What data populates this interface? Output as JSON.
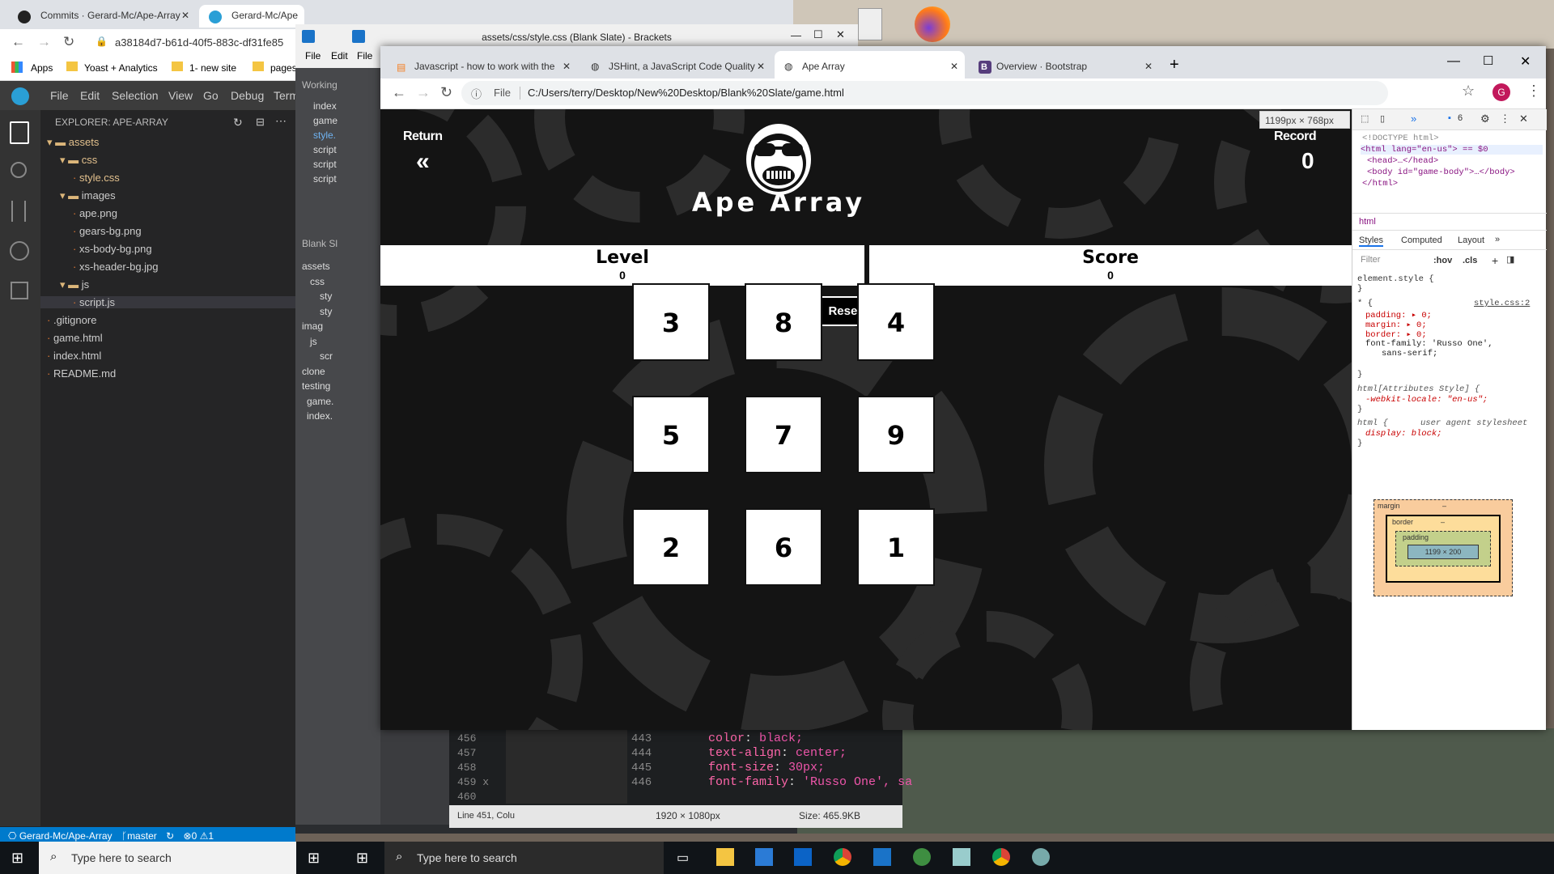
{
  "back_browser": {
    "tabs": [
      {
        "title": "Commits · Gerard-Mc/Ape-Array"
      },
      {
        "title": "Gerard-Mc/Ape"
      }
    ],
    "url": "a38184d7-b61d-40f5-883c-df31fe85",
    "bookmarks": [
      "Apps",
      "Yoast + Analytics",
      "1- new site",
      "pages"
    ]
  },
  "vscode": {
    "menu": [
      "File",
      "Edit",
      "Selection",
      "View",
      "Go",
      "Debug",
      "Term"
    ],
    "explorer_title": "EXPLORER: APE-ARRAY",
    "tree": [
      {
        "label": "assets",
        "depth": 0,
        "kind": "folder"
      },
      {
        "label": "css",
        "depth": 1,
        "kind": "folder"
      },
      {
        "label": "style.css",
        "depth": 2,
        "kind": "file"
      },
      {
        "label": "images",
        "depth": 1,
        "kind": "folder"
      },
      {
        "label": "ape.png",
        "depth": 2,
        "kind": "file"
      },
      {
        "label": "gears-bg.png",
        "depth": 2,
        "kind": "file"
      },
      {
        "label": "xs-body-bg.png",
        "depth": 2,
        "kind": "file"
      },
      {
        "label": "xs-header-bg.jpg",
        "depth": 2,
        "kind": "file"
      },
      {
        "label": "js",
        "depth": 1,
        "kind": "folder"
      },
      {
        "label": "script.js",
        "depth": 2,
        "kind": "file"
      },
      {
        "label": ".gitignore",
        "depth": 0,
        "kind": "file"
      },
      {
        "label": "game.html",
        "depth": 0,
        "kind": "file"
      },
      {
        "label": "index.html",
        "depth": 0,
        "kind": "file"
      },
      {
        "label": "README.md",
        "depth": 0,
        "kind": "file"
      }
    ],
    "status_repo": "Gerard-Mc/Ape-Array",
    "status_branch": "master",
    "status_problems": "0",
    "status_warnings": "1"
  },
  "brackets": {
    "title": "assets/css/style.css (Blank Slate) - Brackets",
    "menu": [
      "File",
      "Edit",
      "File"
    ],
    "working_label": "Working",
    "working_files": [
      "index",
      "game",
      "style.",
      "script",
      "script",
      "script"
    ],
    "project_label": "Blank Sl",
    "project_items": [
      "assets",
      "css",
      "sty",
      "sty",
      "imag",
      "js",
      "scr",
      "clone",
      "testing",
      "game.",
      "index."
    ],
    "line_numbers": [
      "456",
      "457",
      "458",
      "459 x",
      "460"
    ],
    "code_line_numbers": [
      "443",
      "444",
      "445",
      "446"
    ],
    "code_lines": [
      {
        "prop": "color",
        "val": "black;"
      },
      {
        "prop": "text-align",
        "val": "center;"
      },
      {
        "prop": "font-size",
        "val": "30px;"
      },
      {
        "prop": "font-family",
        "val": "'Russo One', sa"
      }
    ],
    "status_cursor": "Line 451, Colu",
    "status_dimensions": "1920 × 1080px",
    "status_size": "Size: 465.9KB"
  },
  "taskbar": {
    "search_placeholder": "Type here to search",
    "search_placeholder_2": "Type here to search"
  },
  "browser": {
    "tabs": [
      {
        "title": "Javascript - how to work with the",
        "active": false
      },
      {
        "title": "JSHint, a JavaScript Code Quality",
        "active": false
      },
      {
        "title": "Ape Array",
        "active": true
      },
      {
        "title": "Overview · Bootstrap",
        "active": false
      }
    ],
    "url_scheme": "File",
    "url": "C:/Users/terry/Desktop/New%20Desktop/Blank%20Slate/game.html",
    "profile_initial": "G",
    "viewport_size": "1199px × 768px"
  },
  "game": {
    "return_label": "Return",
    "back_glyph": "«",
    "record_label": "Record",
    "record_value": "0",
    "title": "Ape Array",
    "level_label": "Level",
    "level_value": "0",
    "score_label": "Score",
    "score_value": "0",
    "reset_label": "Reset Scores",
    "tiles": [
      "3",
      "8",
      "4",
      "5",
      "7",
      "9",
      "2",
      "6",
      "1"
    ]
  },
  "devtools": {
    "messages_count": "6",
    "dom": [
      "<!DOCTYPE html>",
      "<html lang=\"en-us\"> == $0",
      "<head>…</head>",
      "<body id=\"game-body\">…</body>",
      "</html>"
    ],
    "breadcrumb": "html",
    "tabs": [
      "Styles",
      "Computed",
      "Layout"
    ],
    "filter_placeholder": "Filter",
    "hov": ":hov",
    "cls": ".cls",
    "rules": {
      "element_style": "element.style {",
      "universal_selector": "* {",
      "universal_source": "style.css:2",
      "universal_decls": [
        "padding: ▸ 0;",
        "margin: ▸ 0;",
        "border: ▸ 0;",
        "font-family: 'Russo One',",
        "sans-serif;"
      ],
      "attr_selector": "html[Attributes Style] {",
      "attr_decl": "-webkit-locale: \"en-us\";",
      "ua_selector": "html {",
      "ua_source": "user agent stylesheet",
      "ua_decl": "display: block;"
    },
    "boxmodel": {
      "margin_label": "margin",
      "border_label": "border",
      "padding_label": "padding",
      "content": "1199 × 200",
      "dash": "–"
    }
  }
}
